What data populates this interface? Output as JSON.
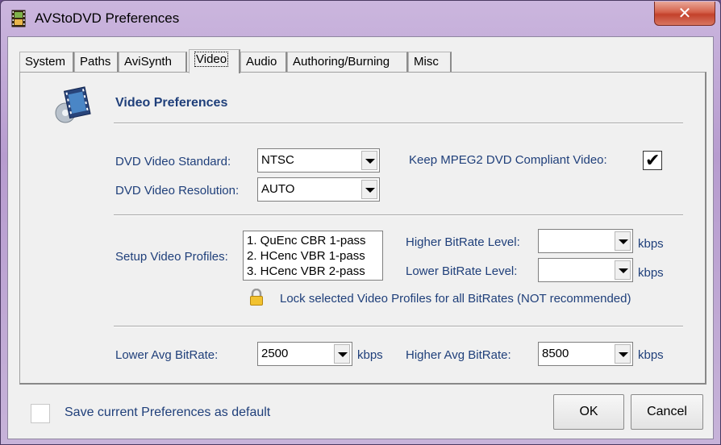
{
  "window": {
    "title": "AVStoDVD Preferences",
    "close_symbol": "✕"
  },
  "tabs": [
    "System",
    "Paths",
    "AviSynth",
    "Video",
    "Audio",
    "Authoring/Burning",
    "Misc"
  ],
  "active_tab": "Video",
  "panel": {
    "heading": "Video Preferences",
    "dvd_standard": {
      "label": "DVD Video Standard:",
      "value": "NTSC"
    },
    "dvd_resolution": {
      "label": "DVD Video Resolution:",
      "value": "AUTO"
    },
    "keep_mpeg2": {
      "label": "Keep MPEG2 DVD Compliant Video:",
      "checked": true,
      "mark": "✔"
    },
    "profiles": {
      "label": "Setup Video Profiles:",
      "items": [
        "1. QuEnc CBR 1-pass",
        "2. HCenc VBR 1-pass",
        "3. HCenc VBR 2-pass"
      ]
    },
    "higher_bitrate_level": {
      "label": "Higher BitRate Level:",
      "value": "",
      "unit": "kbps"
    },
    "lower_bitrate_level": {
      "label": "Lower BitRate Level:",
      "value": "",
      "unit": "kbps"
    },
    "lock_text": "Lock selected Video Profiles for all BitRates (NOT recommended)",
    "lower_avg_bitrate": {
      "label": "Lower Avg BitRate:",
      "value": "2500",
      "unit": "kbps"
    },
    "higher_avg_bitrate": {
      "label": "Higher Avg BitRate:",
      "value": "8500",
      "unit": "kbps"
    }
  },
  "footer": {
    "save_default_label": "Save current Preferences as default",
    "ok_label": "OK",
    "cancel_label": "Cancel"
  }
}
